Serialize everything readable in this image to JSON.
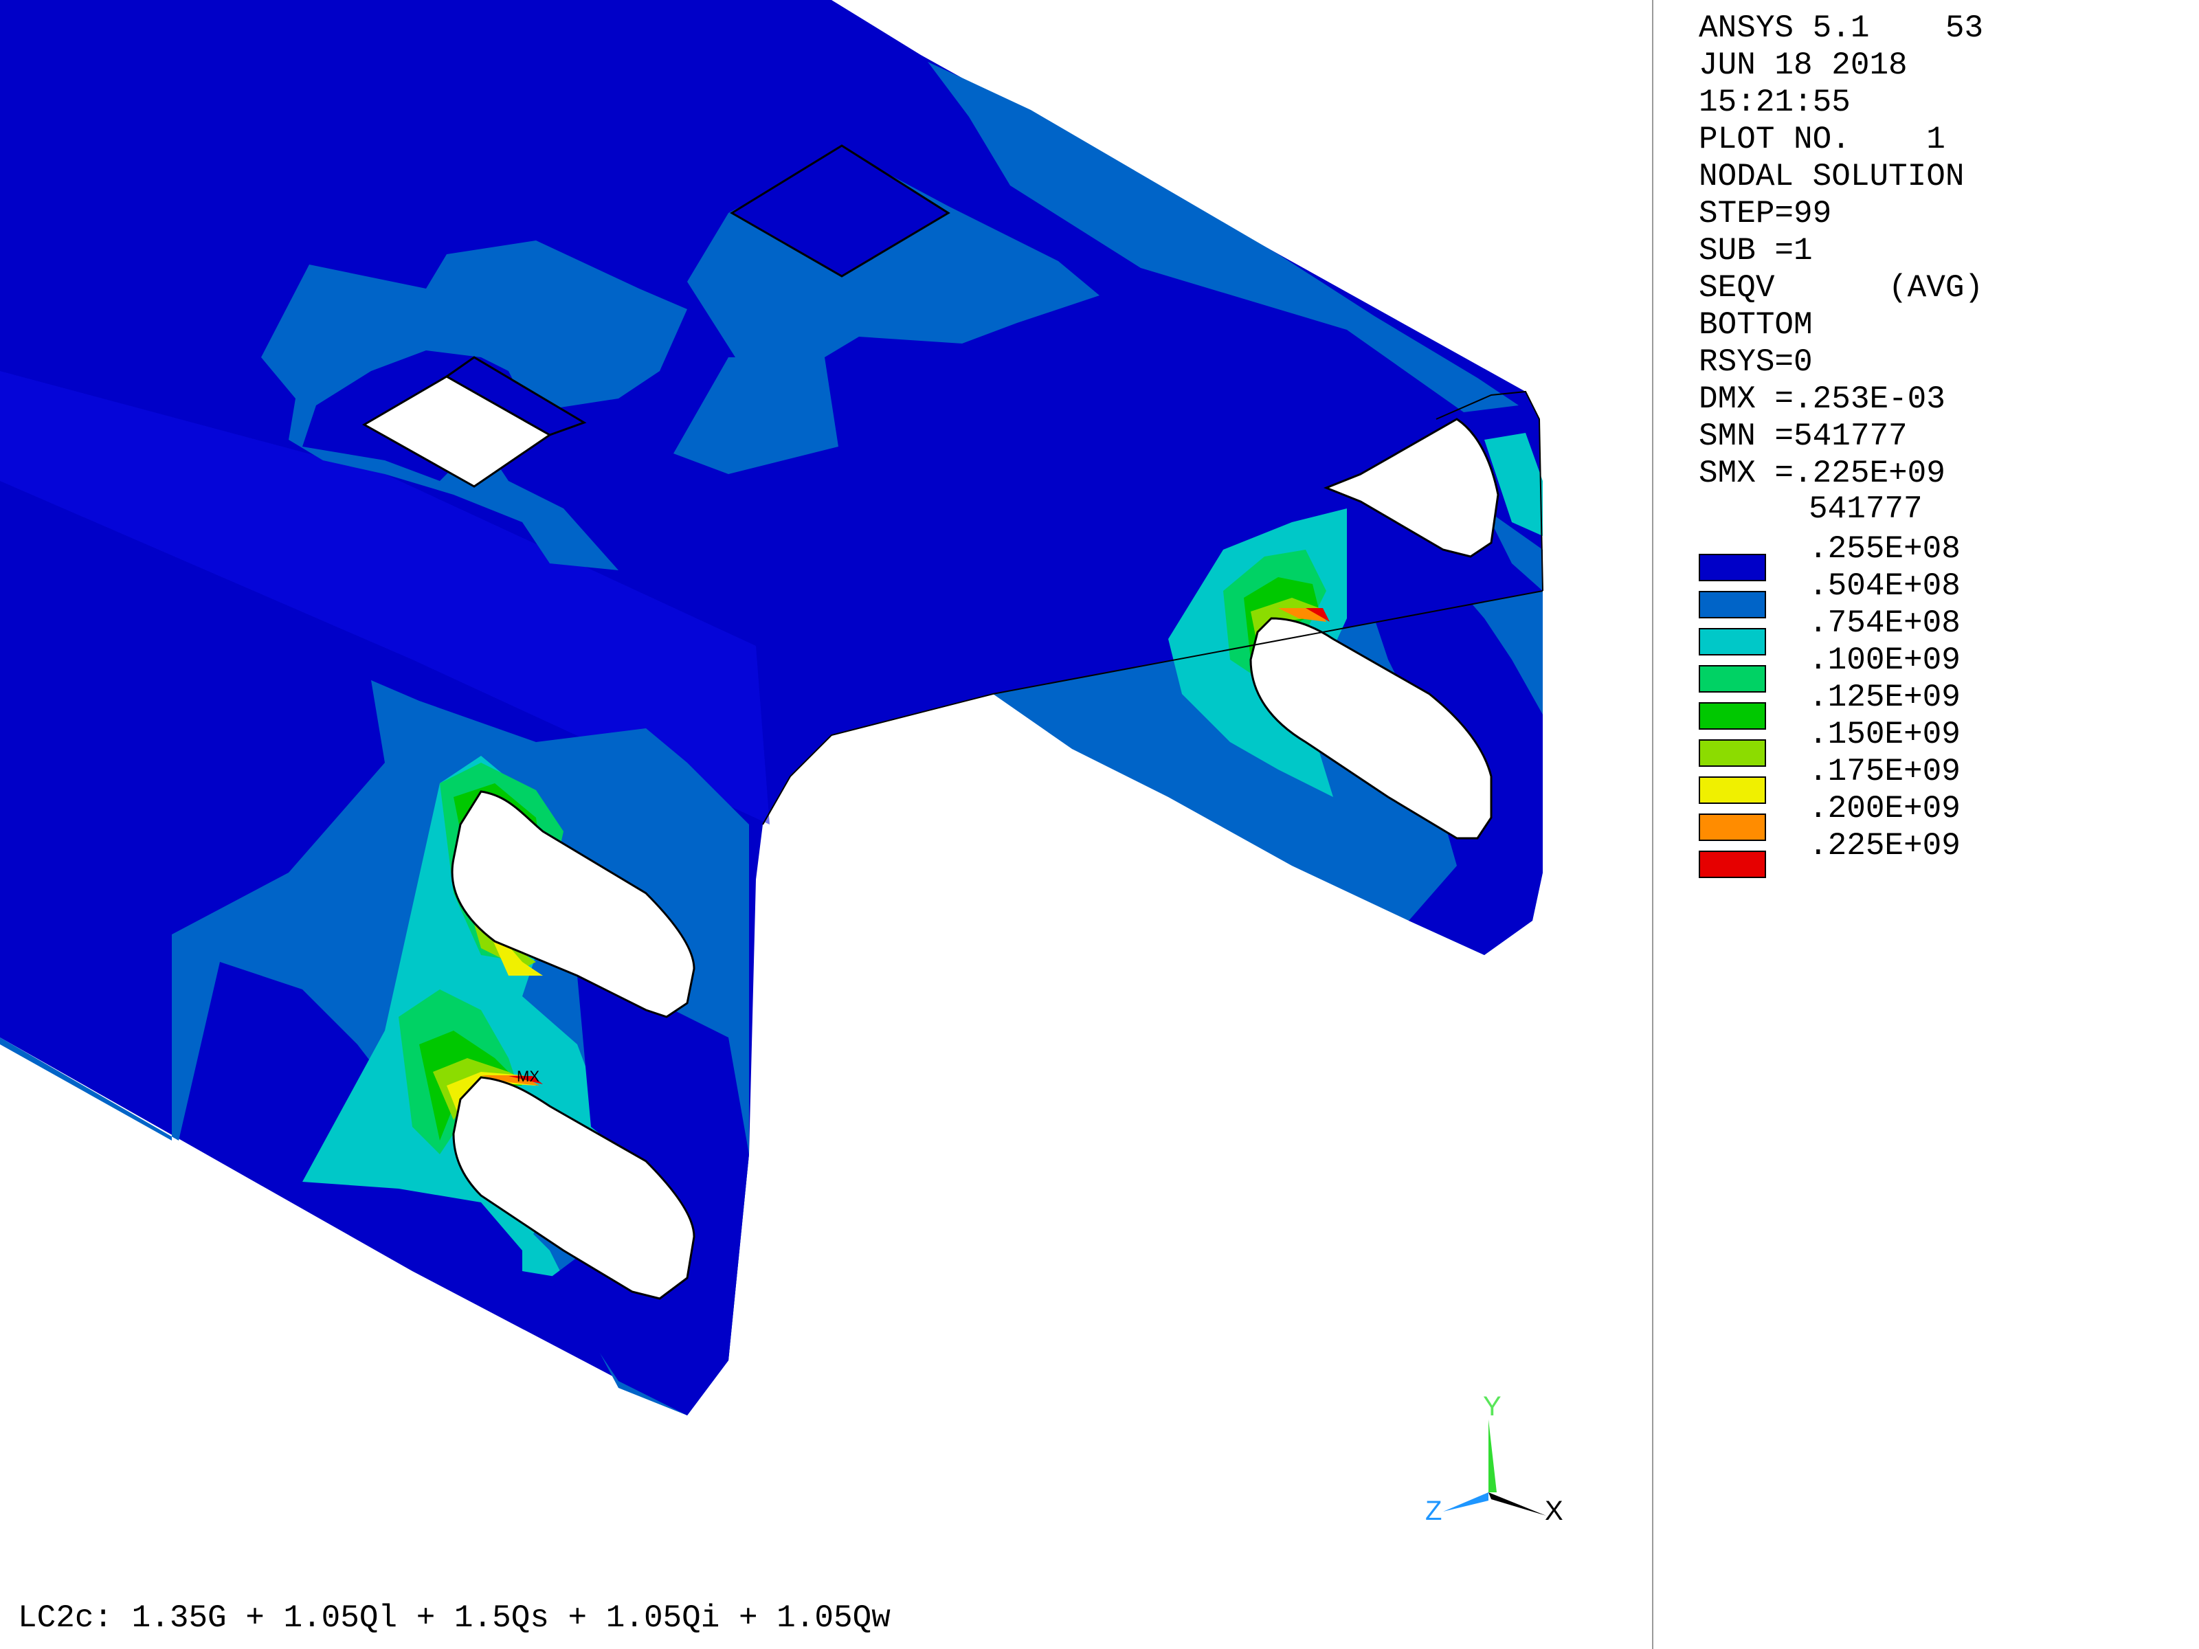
{
  "info": {
    "lines": [
      "ANSYS 5.1    53",
      "JUN 18 2018",
      "15:21:55",
      "PLOT NO.    1",
      "NODAL SOLUTION",
      "STEP=99",
      "SUB =1",
      "SEQV      (AVG)",
      "BOTTOM",
      "RSYS=0",
      "DMX =.253E-03",
      "SMN =541777",
      "SMX =.225E+09"
    ]
  },
  "legend": {
    "min_label": "541777",
    "items": [
      {
        "label": ".255E+08",
        "color": "#0000C8"
      },
      {
        "label": ".504E+08",
        "color": "#0064C8"
      },
      {
        "label": ".754E+08",
        "color": "#00C8C8"
      },
      {
        "label": ".100E+09",
        "color": "#00D264"
      },
      {
        "label": ".125E+09",
        "color": "#00C800"
      },
      {
        "label": ".150E+09",
        "color": "#8CDC00"
      },
      {
        "label": ".175E+09",
        "color": "#F0F000"
      },
      {
        "label": ".200E+09",
        "color": "#FF8C00"
      },
      {
        "label": ".225E+09",
        "color": "#E60000"
      }
    ]
  },
  "plot": {
    "max_marker": "MX"
  },
  "axes": {
    "x": "X",
    "y": "Y",
    "z": "Z"
  },
  "caption": "LC2c: 1.35G + 1.05Ql + 1.5Qs + 1.05Qi + 1.05Qw"
}
